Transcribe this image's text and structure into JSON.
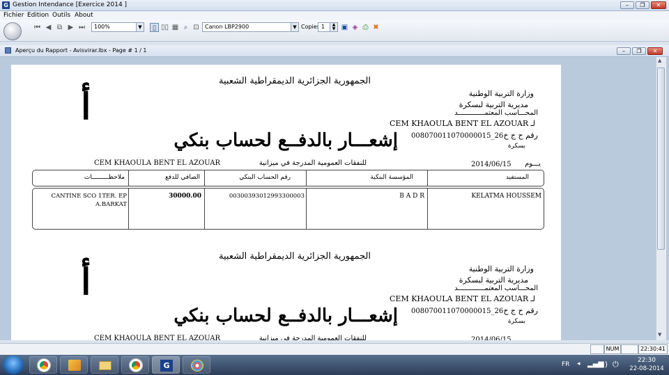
{
  "window": {
    "title": "Gestion Intendance [Exercice  2014 ]",
    "app_icon": "G"
  },
  "menu": [
    "Fichier",
    "Edition",
    "Outils",
    "About"
  ],
  "toolbar": {
    "zoom": "100%",
    "printer": "Canon LBP2900",
    "copies_label": "Copies",
    "copies": "1"
  },
  "child": {
    "title": "Aperçu du Rapport - Avisvirar.lbx - Page # 1 / 1"
  },
  "report": {
    "header": "الجمهورية الجزائرية الديمقراطية الشعبية",
    "ministry": "وزارة التربية الوطنية",
    "directorate": "مديرية التربية لبسكرة",
    "accountant": "المحـــاسب المعتمـــــــــــــد",
    "to_prefix": "لـ",
    "school": "CEM KHAOULA BENT  EL AZOUAR",
    "account_label": "رقم ح ج خ",
    "account": "008070011070000015_26",
    "city": "بسكرة",
    "big_letter": "أ",
    "title": "إشعـــار بالدفــع  لحساب بنكي",
    "day_label": "يـــوم",
    "date": "2014/06/15",
    "budget_text": "للنفقات العمومية المدرجة  في ميزانية",
    "columns": {
      "beneficiary": "المستفيد",
      "bank": "المؤسسة البنكية",
      "rib": "رقم الحساب البنكي",
      "net": "الصافي للدفع",
      "notes": "ملاحظـــــــــات"
    },
    "row": {
      "beneficiary": "KELATMA HOUSSEM",
      "bank": "B A D R",
      "rib": "00300393012993300003",
      "net": "30000.00",
      "notes_1": "CANTINE SCO 1TER. EP",
      "notes_2": "A.BARKAT"
    }
  },
  "status": {
    "num": "NUM",
    "time": "22:30:41"
  },
  "taskbar": {
    "lang": "FR",
    "clock_time": "22:30",
    "clock_date": "22-08-2014"
  },
  "colors": {
    "accent": "#1b3f8b",
    "close": "#c0392b",
    "taskbar": "#2c3d57"
  }
}
